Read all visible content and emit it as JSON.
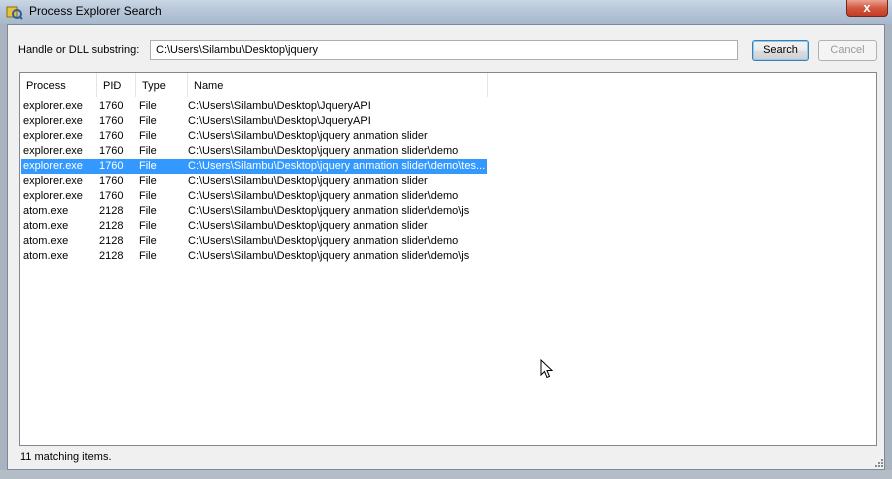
{
  "window": {
    "title": "Process Explorer Search",
    "close_label": "x"
  },
  "search": {
    "label": "Handle or DLL substring:",
    "value": "C:\\Users\\Silambu\\Desktop\\jquery",
    "search_label": "Search",
    "cancel_label": "Cancel"
  },
  "table": {
    "columns": [
      "Process",
      "PID",
      "Type",
      "Name"
    ],
    "sorted_column": "PID",
    "rows": [
      {
        "process": "explorer.exe",
        "pid": "1760",
        "type": "File",
        "name": "C:\\Users\\Silambu\\Desktop\\JqueryAPI"
      },
      {
        "process": "explorer.exe",
        "pid": "1760",
        "type": "File",
        "name": "C:\\Users\\Silambu\\Desktop\\JqueryAPI"
      },
      {
        "process": "explorer.exe",
        "pid": "1760",
        "type": "File",
        "name": "C:\\Users\\Silambu\\Desktop\\jquery anmation slider"
      },
      {
        "process": "explorer.exe",
        "pid": "1760",
        "type": "File",
        "name": "C:\\Users\\Silambu\\Desktop\\jquery anmation slider\\demo"
      },
      {
        "process": "explorer.exe",
        "pid": "1760",
        "type": "File",
        "name": "C:\\Users\\Silambu\\Desktop\\jquery anmation slider\\demo\\tes..."
      },
      {
        "process": "explorer.exe",
        "pid": "1760",
        "type": "File",
        "name": "C:\\Users\\Silambu\\Desktop\\jquery anmation slider"
      },
      {
        "process": "explorer.exe",
        "pid": "1760",
        "type": "File",
        "name": "C:\\Users\\Silambu\\Desktop\\jquery anmation slider\\demo"
      },
      {
        "process": "atom.exe",
        "pid": "2128",
        "type": "File",
        "name": "C:\\Users\\Silambu\\Desktop\\jquery anmation slider\\demo\\js"
      },
      {
        "process": "atom.exe",
        "pid": "2128",
        "type": "File",
        "name": "C:\\Users\\Silambu\\Desktop\\jquery anmation slider"
      },
      {
        "process": "atom.exe",
        "pid": "2128",
        "type": "File",
        "name": "C:\\Users\\Silambu\\Desktop\\jquery anmation slider\\demo"
      },
      {
        "process": "atom.exe",
        "pid": "2128",
        "type": "File",
        "name": "C:\\Users\\Silambu\\Desktop\\jquery anmation slider\\demo\\js"
      }
    ],
    "selected_row": 4
  },
  "status": {
    "text": "11 matching items."
  },
  "background": {
    "title_text": "",
    "bottom_text": ""
  },
  "colors": {
    "selection": "#3399ff",
    "titlebar": "#b7c6d8",
    "close_button": "#c23c22"
  },
  "icons": {
    "app": "process-explorer-icon",
    "close": "close-icon",
    "sort": "sort-up-icon",
    "grip": "size-grip-icon",
    "cursor": "mouse-cursor-icon"
  }
}
